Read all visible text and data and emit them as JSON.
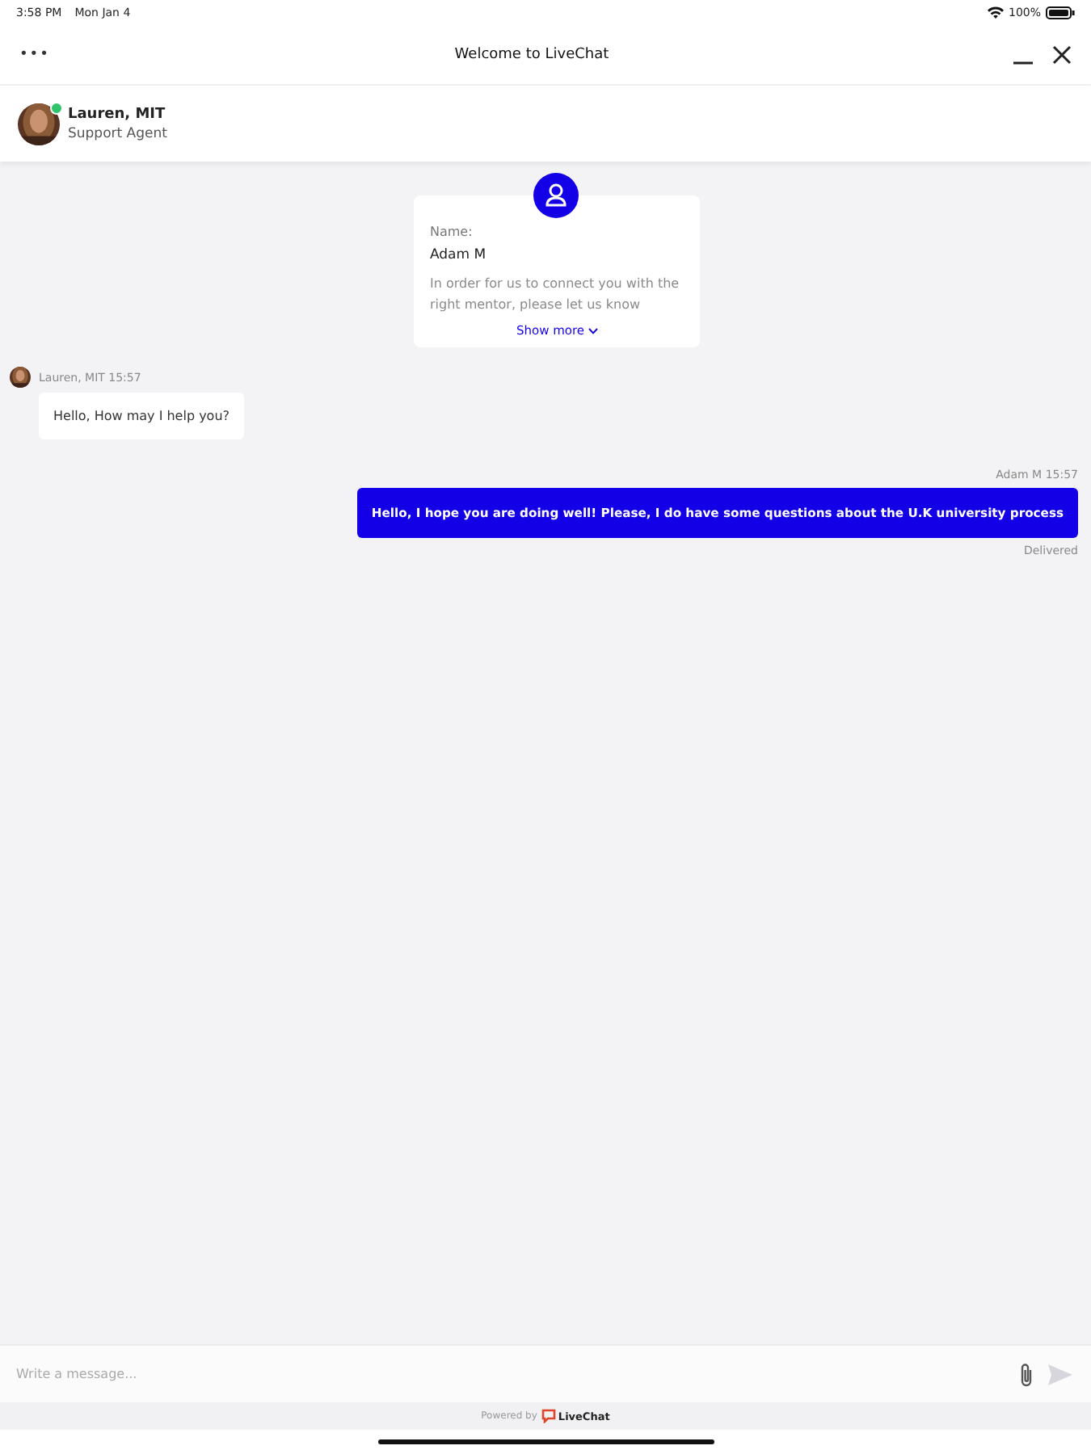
{
  "status_bar": {
    "time": "3:58 PM",
    "date": "Mon Jan 4",
    "battery": "100%"
  },
  "header": {
    "menu": "•••",
    "title": "Welcome to LiveChat"
  },
  "agent": {
    "name": "Lauren, MIT",
    "role": "Support Agent",
    "online": true
  },
  "form_card": {
    "field_label": "Name:",
    "field_value": "Adam M",
    "description": "In order for us to connect you with the right mentor, please let us know",
    "link": "Show more"
  },
  "messages": [
    {
      "kind": "incoming",
      "author": "Lauren, MIT 15:57",
      "text": "Hello, How may I help you?"
    },
    {
      "kind": "outgoing",
      "author": "Adam M 15:57",
      "text": "Hello, I hope you are doing well! Please, I do have some questions about the U.K university process",
      "status": "Delivered"
    }
  ],
  "composer": {
    "placeholder": "Write a message..."
  },
  "footer": {
    "powered_by": "Powered by",
    "brand": "LiveChat"
  }
}
